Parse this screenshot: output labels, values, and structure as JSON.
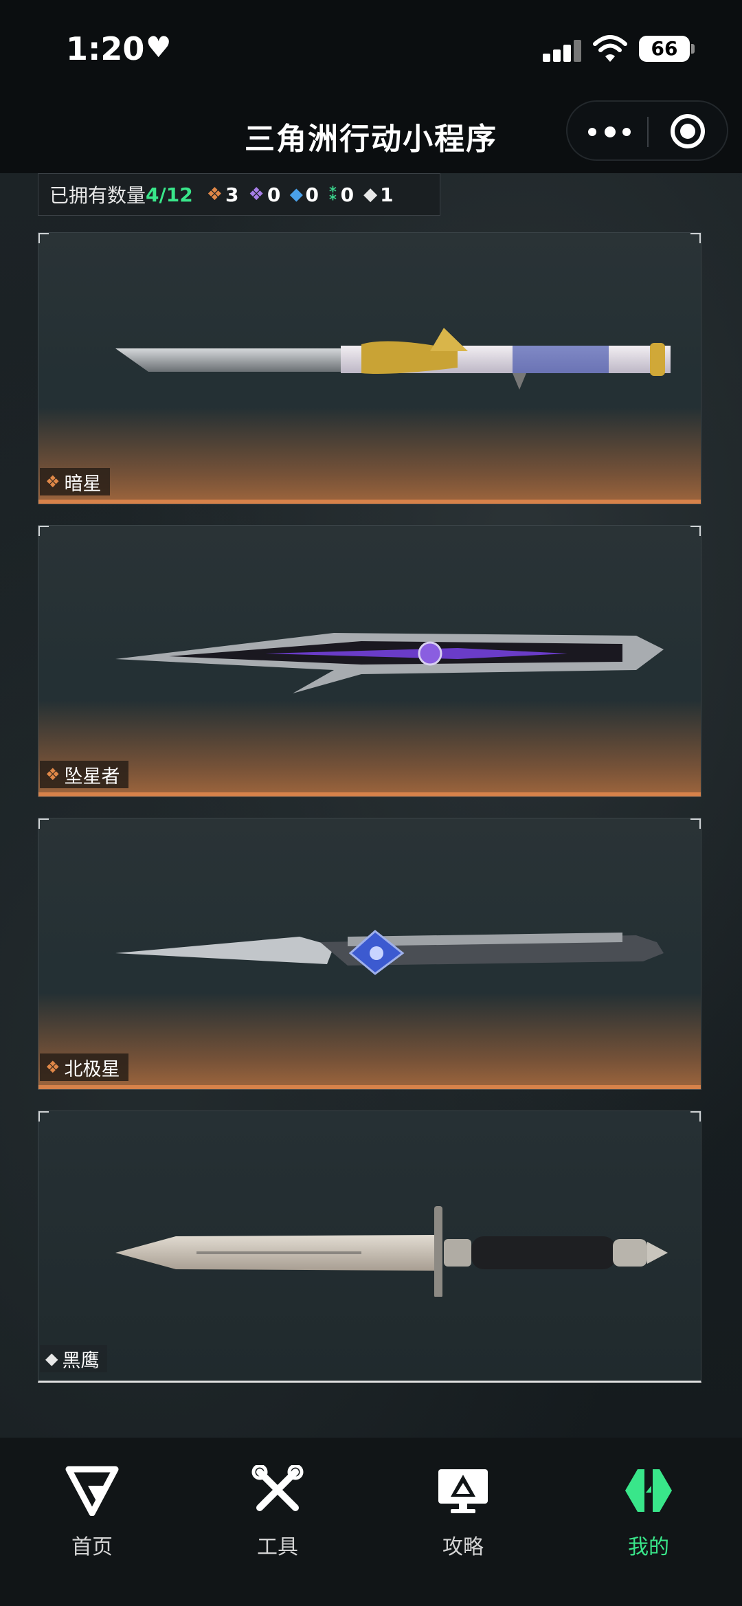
{
  "status_bar": {
    "time": "1:20",
    "battery": "66"
  },
  "nav": {
    "title": "三角洲行动小程序"
  },
  "collection": {
    "owned_label": "已拥有数量",
    "owned_value": "4/12",
    "rarity_counts": [
      {
        "color": "orange",
        "count": "3"
      },
      {
        "color": "purple",
        "count": "0"
      },
      {
        "color": "blue",
        "count": "0"
      },
      {
        "color": "green",
        "count": "0"
      },
      {
        "color": "white",
        "count": "1"
      }
    ]
  },
  "knives": [
    {
      "name": "暗星",
      "rarity": "orange"
    },
    {
      "name": "坠星者",
      "rarity": "orange"
    },
    {
      "name": "北极星",
      "rarity": "orange"
    },
    {
      "name": "黑鹰",
      "rarity": "white"
    }
  ],
  "tab_bar": {
    "items": [
      {
        "label": "首页",
        "icon": "home-g-icon"
      },
      {
        "label": "工具",
        "icon": "tools-icon"
      },
      {
        "label": "攻略",
        "icon": "guide-monitor-icon"
      },
      {
        "label": "我的",
        "icon": "profile-logo-icon",
        "active": true
      }
    ]
  },
  "colors": {
    "accent_green": "#39e68a",
    "rarity_orange": "#e08848"
  }
}
